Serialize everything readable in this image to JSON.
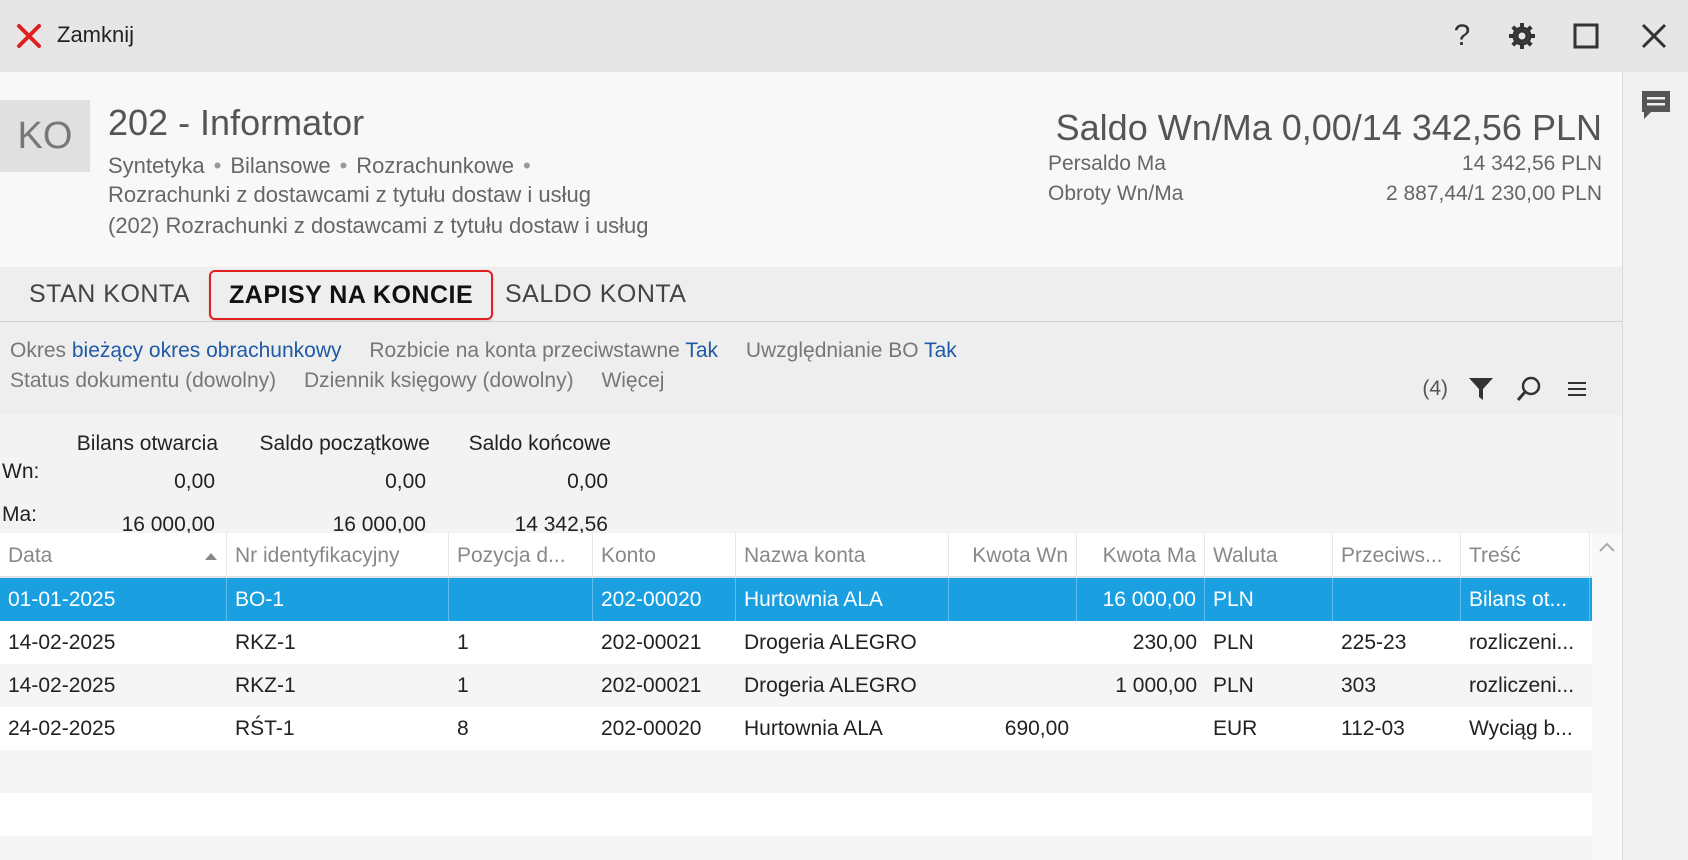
{
  "titlebar": {
    "close_label": "Zamknij",
    "icons": [
      "help-icon",
      "gear-icon",
      "maximize-icon",
      "close-window-icon"
    ],
    "help_glyph": "?"
  },
  "account": {
    "badge": "KO",
    "title": "202 - Informator",
    "tags": [
      "Syntetyka",
      "Bilansowe",
      "Rozrachunkowe"
    ],
    "desc1": "Rozrachunki z dostawcami z tytułu dostaw i usług",
    "desc2": "(202) Rozrachunki z dostawcami z tytułu dostaw i usług",
    "saldo_title": "Saldo Wn/Ma 0,00/14 342,56 PLN",
    "persaldo_label": "Persaldo Ma",
    "persaldo_value": "14 342,56 PLN",
    "obroty_label": "Obroty Wn/Ma",
    "obroty_value": "2 887,44/1 230,00 PLN"
  },
  "tabs": [
    {
      "label": "STAN KONTA",
      "active": false
    },
    {
      "label": "ZAPISY NA KONCIE",
      "active": true
    },
    {
      "label": "SALDO KONTA",
      "active": false
    }
  ],
  "filters": {
    "okres_label": "Okres",
    "okres_value": "bieżący okres obrachunkowy",
    "rozbicie_label": "Rozbicie na konta przeciwstawne",
    "rozbicie_value": "Tak",
    "bo_label": "Uwzględnianie BO",
    "bo_value": "Tak",
    "status": "Status dokumentu (dowolny)",
    "dziennik": "Dziennik księgowy (dowolny)",
    "wiecej": "Więcej",
    "count": "(4)"
  },
  "summary": {
    "headers": [
      "Bilans otwarcia",
      "Saldo początkowe",
      "Saldo końcowe"
    ],
    "wn_label": "Wn:",
    "ma_label": "Ma:",
    "wn": [
      "0,00",
      "0,00",
      "0,00"
    ],
    "ma": [
      "16 000,00",
      "16 000,00",
      "14 342,56"
    ]
  },
  "grid": {
    "columns": [
      "Data",
      "Nr identyfikacyjny",
      "Pozycja d...",
      "Konto",
      "Nazwa konta",
      "Kwota Wn",
      "Kwota Ma",
      "Waluta",
      "Przeciws...",
      "Treść"
    ],
    "rows": [
      [
        "01-01-2025",
        "BO-1",
        "",
        "202-00020",
        "Hurtownia ALA",
        "",
        "16 000,00",
        "PLN",
        "",
        "Bilans ot..."
      ],
      [
        "14-02-2025",
        "RKZ-1",
        "1",
        "202-00021",
        "Drogeria ALEGRO",
        "",
        "230,00",
        "PLN",
        "225-23",
        "rozliczeni..."
      ],
      [
        "14-02-2025",
        "RKZ-1",
        "1",
        "202-00021",
        "Drogeria ALEGRO",
        "",
        "1 000,00",
        "PLN",
        "303",
        "rozliczeni..."
      ],
      [
        "24-02-2025",
        "RŚT-1",
        "8",
        "202-00020",
        "Hurtownia ALA",
        "690,00",
        "",
        "EUR",
        "112-03",
        "Wyciąg b..."
      ]
    ],
    "selected_row": 0
  },
  "colors": {
    "accent_red": "#e02020",
    "selection_blue": "#1a9fe0",
    "link_blue": "#1f5aa6"
  }
}
